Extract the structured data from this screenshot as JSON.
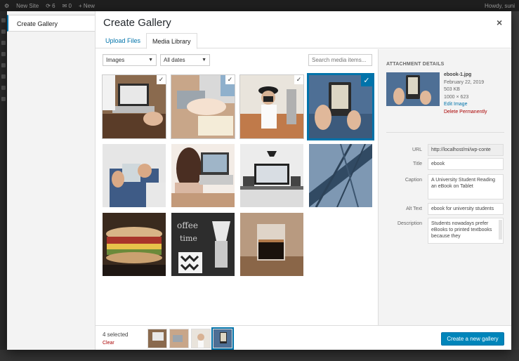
{
  "adminbar": {
    "site": "New Site",
    "updates": "6",
    "comments": "0",
    "new": "+ New",
    "howdy": "Howdy, suni"
  },
  "menu": {
    "create_gallery": "Create Gallery"
  },
  "header": {
    "title": "Create Gallery",
    "close": "×"
  },
  "tabs": {
    "upload": "Upload Files",
    "library": "Media Library"
  },
  "filters": {
    "type": "Images",
    "date": "All dates",
    "search_placeholder": "Search media items..."
  },
  "grid": {
    "checkmark": "✓",
    "items": [
      {
        "name": "laptop-desk",
        "selected": true
      },
      {
        "name": "laptop-notes",
        "selected": true
      },
      {
        "name": "photographer",
        "selected": true
      },
      {
        "name": "ebook-tablet",
        "selected": true,
        "active": true
      },
      {
        "name": "tablet-user",
        "selected": false
      },
      {
        "name": "woman-laptop",
        "selected": false
      },
      {
        "name": "desk-monitor",
        "selected": false
      },
      {
        "name": "bridge-sky",
        "selected": false
      },
      {
        "name": "sandwich",
        "selected": false
      },
      {
        "name": "coffee-chalkboard",
        "selected": false
      },
      {
        "name": "espresso-glass",
        "selected": false
      }
    ]
  },
  "details": {
    "heading": "ATTACHMENT DETAILS",
    "filename": "ebook-1.jpg",
    "date": "February 22, 2019",
    "size": "503 KB",
    "dimensions": "1000 × 623",
    "edit": "Edit Image",
    "delete": "Delete Permanently",
    "url_label": "URL",
    "url": "http://localhost/mi/wp-conte",
    "title_label": "Title",
    "title": "ebook",
    "caption_label": "Caption",
    "caption": "A University Student Reading an eBook on Tablet",
    "alt_label": "Alt Text",
    "alt": "ebook for university students",
    "desc_label": "Description",
    "desc": "Students nowadays prefer eBooks to printed textbooks because they"
  },
  "footer": {
    "selected": "4 selected",
    "clear": "Clear",
    "button": "Create a new gallery"
  },
  "colors": {
    "accent": "#0073aa",
    "button": "#0085ba",
    "danger": "#a00"
  }
}
